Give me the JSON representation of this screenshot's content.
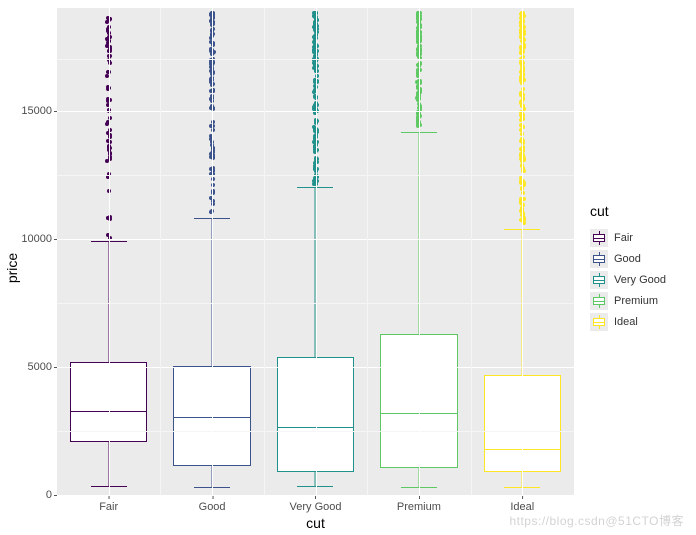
{
  "chart_data": {
    "type": "box",
    "title": "",
    "xlabel": "cut",
    "ylabel": "price",
    "ylim": [
      0,
      19000
    ],
    "y_ticks": [
      0,
      5000,
      10000,
      15000
    ],
    "categories": [
      "Fair",
      "Good",
      "Very Good",
      "Premium",
      "Ideal"
    ],
    "legend_title": "cut",
    "colors": {
      "Fair": "#440154",
      "Good": "#3b528b",
      "Very Good": "#21918c",
      "Premium": "#5ec962",
      "Ideal": "#fde725"
    },
    "series": [
      {
        "name": "Fair",
        "q1": 2050,
        "median": 3280,
        "q3": 5200,
        "lower_whisker": 340,
        "upper_whisker": 9900,
        "outlier_min": 10000,
        "outlier_max": 18600,
        "outlier_n": 70
      },
      {
        "name": "Good",
        "q1": 1150,
        "median": 3050,
        "q3": 5050,
        "lower_whisker": 330,
        "upper_whisker": 10800,
        "outlier_min": 10900,
        "outlier_max": 18800,
        "outlier_n": 120
      },
      {
        "name": "Very Good",
        "q1": 910,
        "median": 2650,
        "q3": 5380,
        "lower_whisker": 340,
        "upper_whisker": 12000,
        "outlier_min": 12100,
        "outlier_max": 18820,
        "outlier_n": 160
      },
      {
        "name": "Premium",
        "q1": 1050,
        "median": 3180,
        "q3": 6300,
        "lower_whisker": 330,
        "upper_whisker": 14150,
        "outlier_min": 14300,
        "outlier_max": 18820,
        "outlier_n": 140
      },
      {
        "name": "Ideal",
        "q1": 880,
        "median": 1810,
        "q3": 4680,
        "lower_whisker": 330,
        "upper_whisker": 10380,
        "outlier_min": 10500,
        "outlier_max": 18810,
        "outlier_n": 200
      }
    ]
  },
  "watermark": "https://blog.csdn@51CTO博客"
}
